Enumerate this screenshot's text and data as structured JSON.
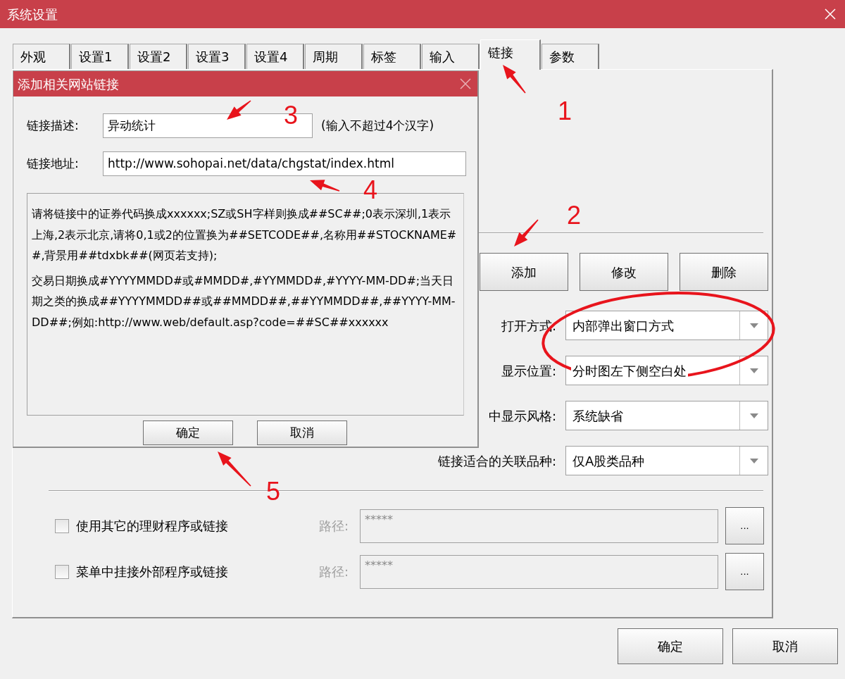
{
  "window": {
    "title": "系统设置"
  },
  "tabs": [
    {
      "label": "外观",
      "selected": false
    },
    {
      "label": "设置1",
      "selected": false
    },
    {
      "label": "设置2",
      "selected": false
    },
    {
      "label": "设置3",
      "selected": false
    },
    {
      "label": "设置4",
      "selected": false
    },
    {
      "label": "周期",
      "selected": false
    },
    {
      "label": "标签",
      "selected": false
    },
    {
      "label": "输入",
      "selected": false
    },
    {
      "label": "链接",
      "selected": true
    },
    {
      "label": "参数",
      "selected": false
    }
  ],
  "link_panel": {
    "buttons": [
      "添加",
      "修改",
      "删除"
    ],
    "settings": [
      {
        "label": "打开方式:",
        "value": "内部弹出窗口方式"
      },
      {
        "label": "显示位置:",
        "value": "分时图左下侧空白处"
      },
      {
        "label": "中显示风格:",
        "value": "系统缺省"
      },
      {
        "label": "链接适合的关联品种:",
        "value": "仅A股类品种"
      }
    ],
    "external": [
      {
        "label": "使用其它的理财程序或链接",
        "checked": false,
        "path_label": "路径:",
        "path_value": "*****",
        "disabled": true,
        "browse": "..."
      },
      {
        "label": "菜单中挂接外部程序或链接",
        "checked": false,
        "path_label": "路径:",
        "path_value": "*****",
        "disabled": true,
        "browse": "..."
      }
    ]
  },
  "footer_buttons": [
    "确定",
    "取消"
  ],
  "dialog": {
    "title": "添加相关网站链接",
    "fields": [
      {
        "label": "链接描述:",
        "value": "异动统计",
        "hint": "(输入不超过4个汉字)"
      },
      {
        "label": "链接地址:",
        "value": "http://www.sohopai.net/data/chgstat/index.html"
      }
    ],
    "notes": [
      "请将链接中的证券代码换成xxxxxx;SZ或SH字样则换成##SC##;0表示深圳,1表示上海,2表示北京,请将0,1或2的位置换为##SETCODE##,名称用##STOCKNAME##,背景用##tdxbk##(网页若支持);",
      "交易日期换成#YYYYMMDD#或#MMDD#,#YYMMDD#,#YYYY-MM-DD#;当天日期之类的换成##YYYYMMDD##或##MMDD##,##YYMMDD##,##YYYY-MM-DD##;例如:http://www.web/default.asp?code=##SC##xxxxxx"
    ],
    "buttons": [
      "确定",
      "取消"
    ]
  },
  "annotations": [
    {
      "label": "1"
    },
    {
      "label": "2"
    },
    {
      "label": "3"
    },
    {
      "label": "4"
    },
    {
      "label": "5"
    }
  ]
}
